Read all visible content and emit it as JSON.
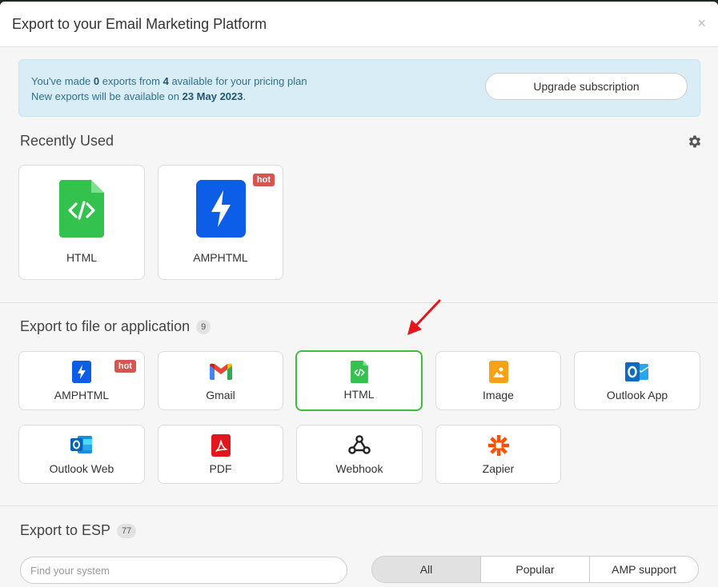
{
  "modal": {
    "title": "Export to your Email Marketing Platform",
    "close_label": "×"
  },
  "banner": {
    "line1_pre": "You've made ",
    "made": "0",
    "line1_mid": " exports from ",
    "available": "4",
    "line1_post": " available for your pricing plan",
    "line2_pre": "New exports will be available on ",
    "date": "23 May 2023",
    "line2_post": ".",
    "upgrade_label": "Upgrade subscription"
  },
  "recently_used": {
    "title": "Recently Used",
    "items": [
      {
        "label": "HTML",
        "icon": "html-file-icon",
        "color": "#33c24d"
      },
      {
        "label": "AMPHTML",
        "icon": "amp-bolt-icon",
        "color": "#0c5de8",
        "badge": "hot"
      }
    ]
  },
  "export_file": {
    "title": "Export to file or application",
    "count": "9",
    "items": [
      {
        "label": "AMPHTML",
        "badge": "hot"
      },
      {
        "label": "Gmail"
      },
      {
        "label": "HTML"
      },
      {
        "label": "Image"
      },
      {
        "label": "Outlook App"
      },
      {
        "label": "Outlook Web"
      },
      {
        "label": "PDF"
      },
      {
        "label": "Webhook"
      },
      {
        "label": "Zapier"
      }
    ]
  },
  "export_esp": {
    "title": "Export to ESP",
    "count": "77",
    "search_placeholder": "Find your system",
    "filters": [
      "All",
      "Popular",
      "AMP support"
    ]
  },
  "colors": {
    "accent_green": "#3dbd3d",
    "hot_red": "#d9534f",
    "banner_bg": "#d9edf7",
    "arrow_red": "#e8141b"
  }
}
